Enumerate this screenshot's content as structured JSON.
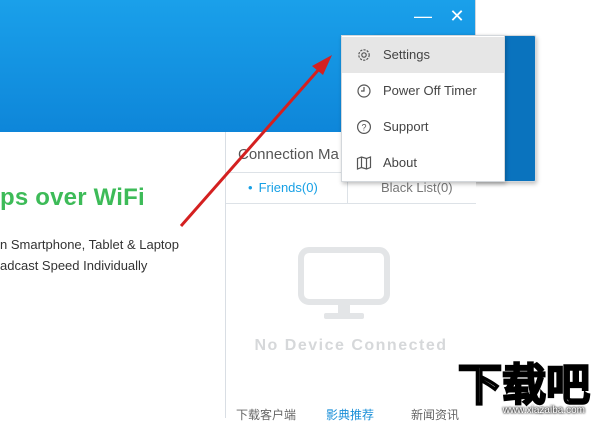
{
  "window": {
    "menu_icon": "triangle-down-icon",
    "minimize_glyph": "—",
    "close_glyph": "✕",
    "accent_color": "#1aa0ea"
  },
  "left": {
    "headline": "ps over WiFi",
    "features": [
      "n Smartphone, Tablet & Laptop",
      "adcast Speed Individually"
    ]
  },
  "connection": {
    "title": "Connection Ma",
    "tabs": {
      "friends": "Friends(0)",
      "black_list": "Black List(0)"
    },
    "empty_text": "No Device Connected",
    "footer": [
      "下载客户端",
      "影典推荐",
      "新闻资讯"
    ]
  },
  "menu": {
    "items": [
      {
        "label": "Settings",
        "icon": "gear-icon",
        "hovered": true
      },
      {
        "label": "Power Off Timer",
        "icon": "clock-icon",
        "hovered": false
      },
      {
        "label": "Support",
        "icon": "help-icon",
        "hovered": false
      },
      {
        "label": "About",
        "icon": "map-icon",
        "hovered": false
      }
    ]
  },
  "watermark": {
    "logo_text": "下载吧",
    "url": "www.xiazaiba.com"
  }
}
